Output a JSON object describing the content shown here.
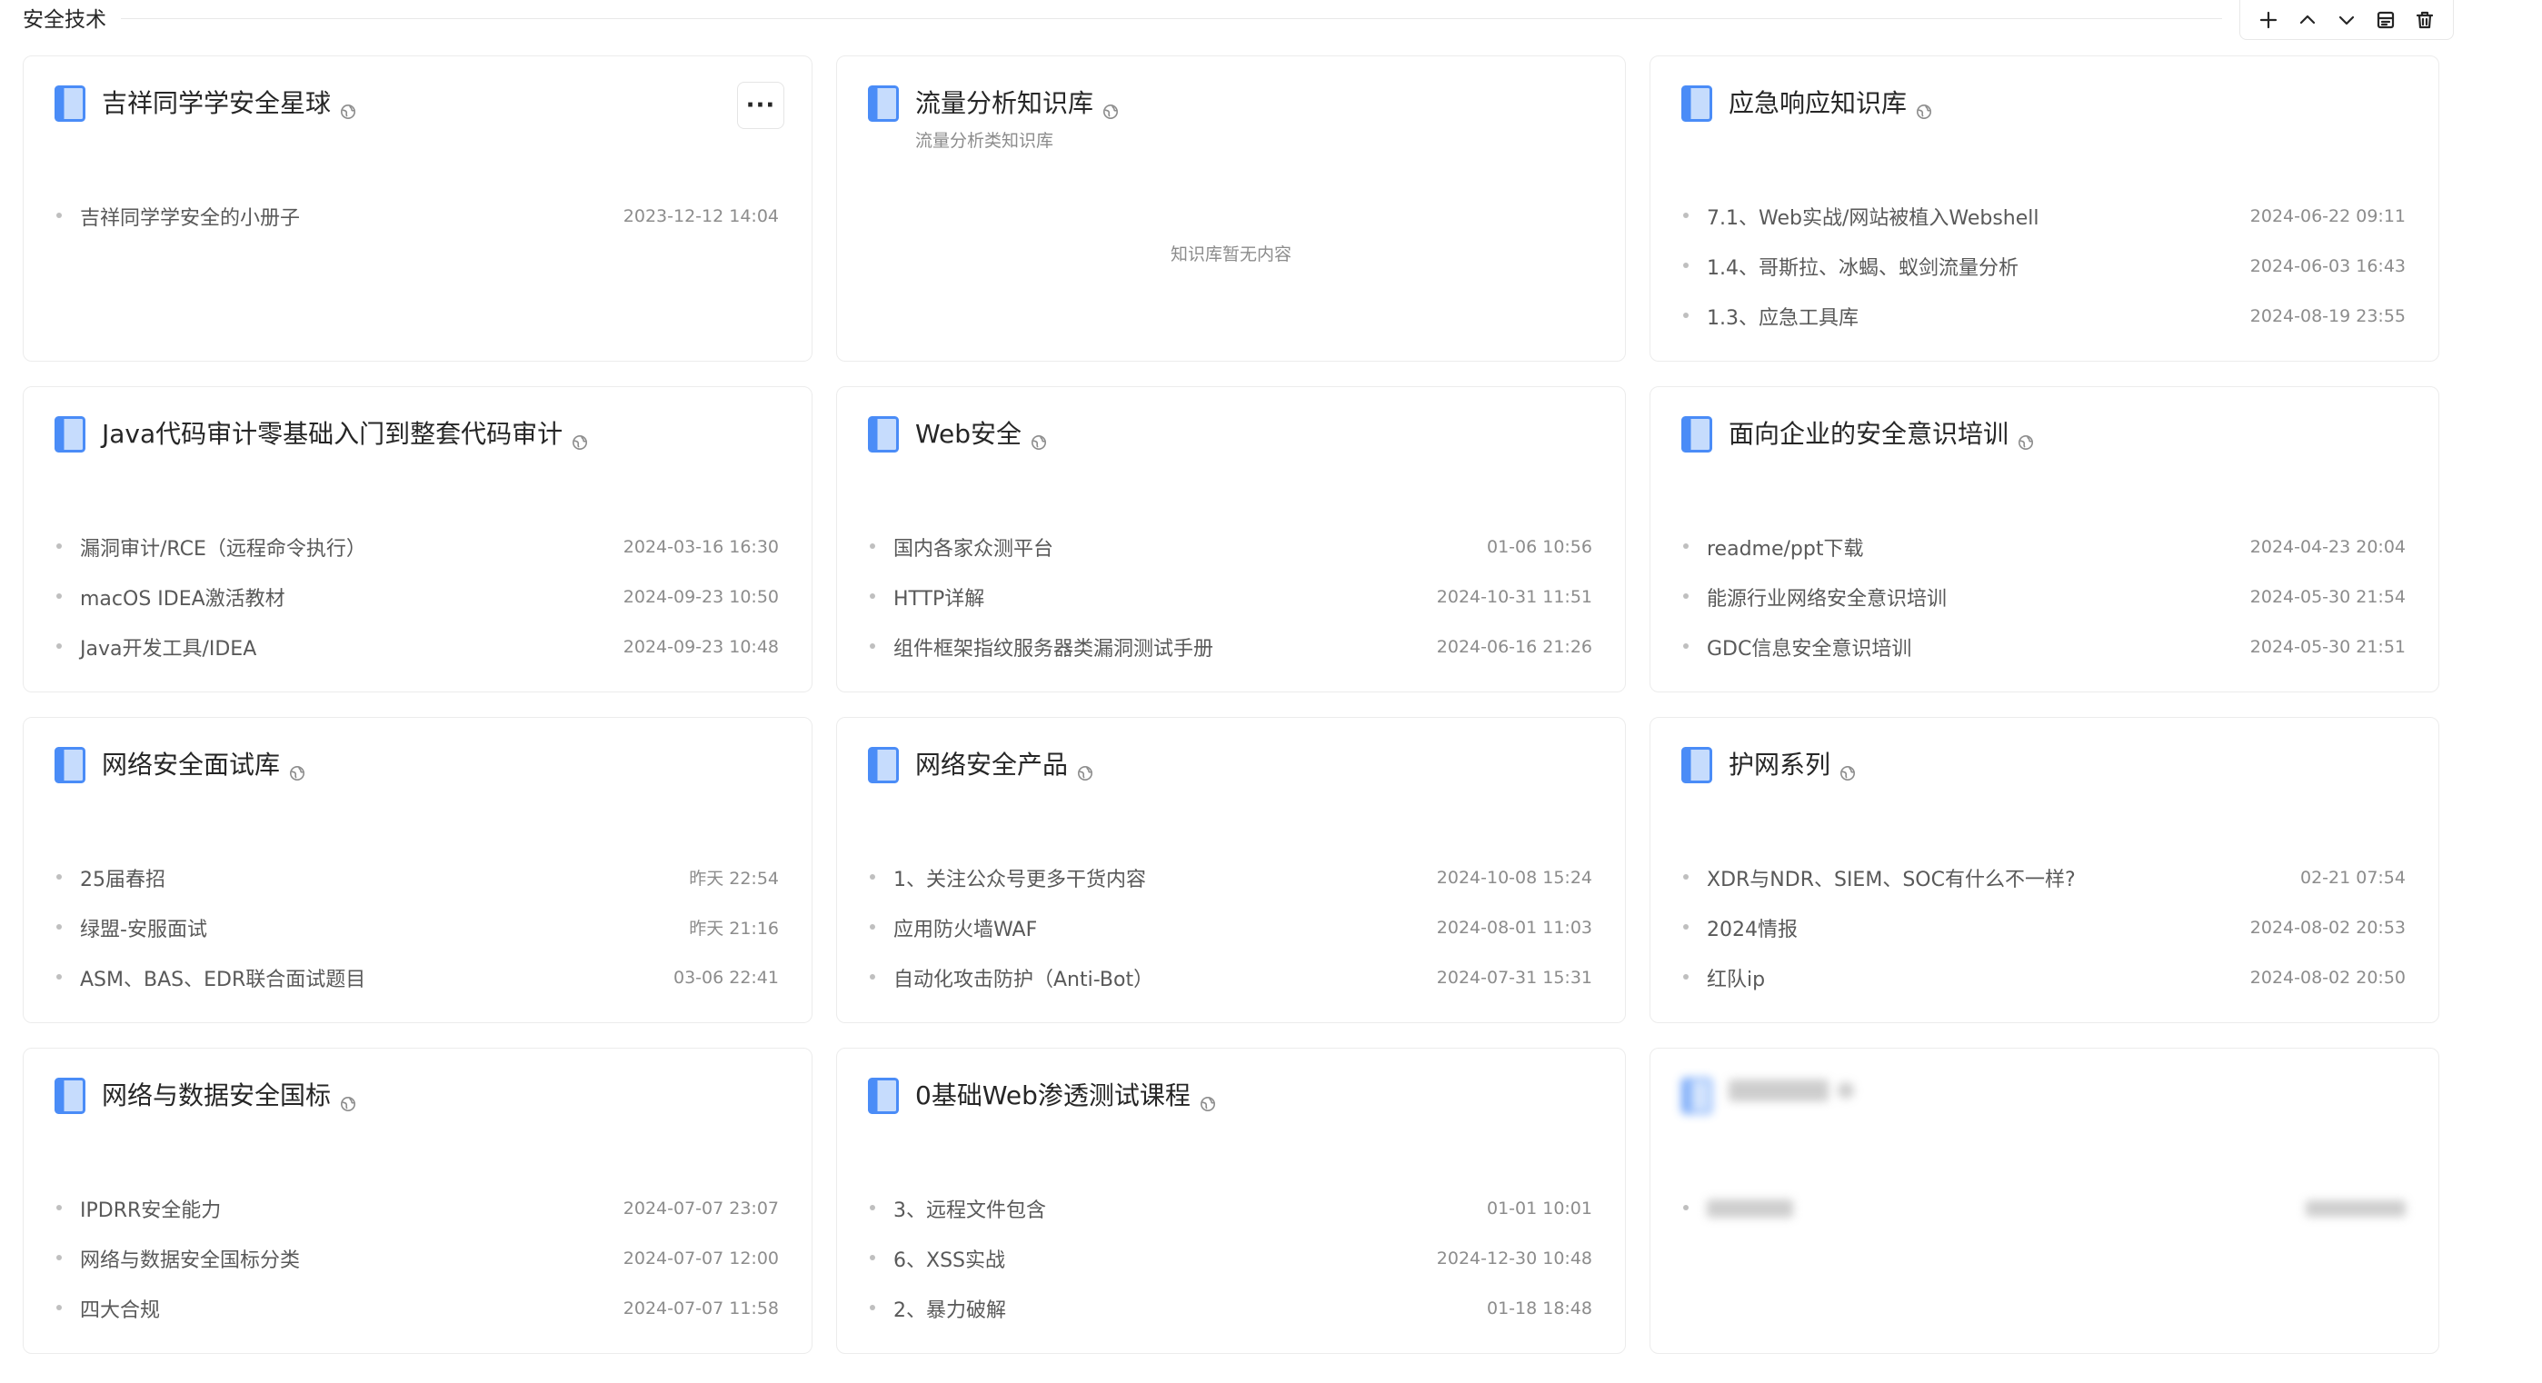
{
  "group": {
    "title": "安全技术"
  },
  "toolbar": {
    "icons": [
      "plus-icon",
      "chevron-up-icon",
      "chevron-down-icon",
      "settings-icon",
      "trash-icon"
    ]
  },
  "colors": {
    "book_icon_blue": "#4a8cf7",
    "book_icon_light": "#c6dcfd",
    "border": "#ececec",
    "muted_text": "#8c8c8c"
  },
  "cards": [
    {
      "title": "吉祥同学学安全星球",
      "more_label": "···",
      "docs": [
        {
          "title": "吉祥同学学安全的小册子",
          "time": "2023-12-12 14:04"
        }
      ]
    },
    {
      "title": "流量分析知识库",
      "description": "流量分析类知识库",
      "empty_text": "知识库暂无内容",
      "docs": []
    },
    {
      "title": "应急响应知识库",
      "docs": [
        {
          "title": "7.1、Web实战/网站被植入Webshell",
          "time": "2024-06-22 09:11"
        },
        {
          "title": "1.4、哥斯拉、冰蝎、蚁剑流量分析",
          "time": "2024-06-03 16:43"
        },
        {
          "title": "1.3、应急工具库",
          "time": "2024-08-19 23:55"
        }
      ]
    },
    {
      "title": "Java代码审计零基础入门到整套代码审计",
      "docs": [
        {
          "title": "漏洞审计/RCE（远程命令执行）",
          "time": "2024-03-16 16:30"
        },
        {
          "title": "macOS IDEA激活教材",
          "time": "2024-09-23 10:50"
        },
        {
          "title": "Java开发工具/IDEA",
          "time": "2024-09-23 10:48"
        }
      ]
    },
    {
      "title": "Web安全",
      "docs": [
        {
          "title": "国内各家众测平台",
          "time": "01-06 10:56"
        },
        {
          "title": "HTTP详解",
          "time": "2024-10-31 11:51"
        },
        {
          "title": "组件框架指纹服务器类漏洞测试手册",
          "time": "2024-06-16 21:26"
        }
      ]
    },
    {
      "title": "面向企业的安全意识培训",
      "docs": [
        {
          "title": "readme/ppt下载",
          "time": "2024-04-23 20:04"
        },
        {
          "title": "能源行业网络安全意识培训",
          "time": "2024-05-30 21:54"
        },
        {
          "title": "GDC信息安全意识培训",
          "time": "2024-05-30 21:51"
        }
      ]
    },
    {
      "title": "网络安全面试库",
      "docs": [
        {
          "title": "25届春招",
          "time": "昨天 22:54"
        },
        {
          "title": "绿盟-安服面试",
          "time": "昨天 21:16"
        },
        {
          "title": "ASM、BAS、EDR联合面试题目",
          "time": "03-06 22:41"
        }
      ]
    },
    {
      "title": "网络安全产品",
      "docs": [
        {
          "title": "1、关注公众号更多干货内容",
          "time": "2024-10-08 15:24"
        },
        {
          "title": "应用防火墙WAF",
          "time": "2024-08-01 11:03"
        },
        {
          "title": "自动化攻击防护（Anti-Bot）",
          "time": "2024-07-31 15:31"
        }
      ]
    },
    {
      "title": "护网系列",
      "docs": [
        {
          "title": "XDR与NDR、SIEM、SOC有什么不一样?",
          "time": "02-21 07:54"
        },
        {
          "title": "2024情报",
          "time": "2024-08-02 20:53"
        },
        {
          "title": "红队ip",
          "time": "2024-08-02 20:50"
        }
      ]
    },
    {
      "title": "网络与数据安全国标",
      "docs": [
        {
          "title": "IPDRR安全能力",
          "time": "2024-07-07 23:07"
        },
        {
          "title": "网络与数据安全国标分类",
          "time": "2024-07-07 12:00"
        },
        {
          "title": "四大合规",
          "time": "2024-07-07 11:58"
        }
      ]
    },
    {
      "title": "0基础Web渗透测试课程",
      "docs": [
        {
          "title": "3、远程文件包含",
          "time": "01-01 10:01"
        },
        {
          "title": "6、XSS实战",
          "time": "2024-12-30 10:48"
        },
        {
          "title": "2、暴力破解",
          "time": "01-18 18:48"
        }
      ]
    }
  ]
}
